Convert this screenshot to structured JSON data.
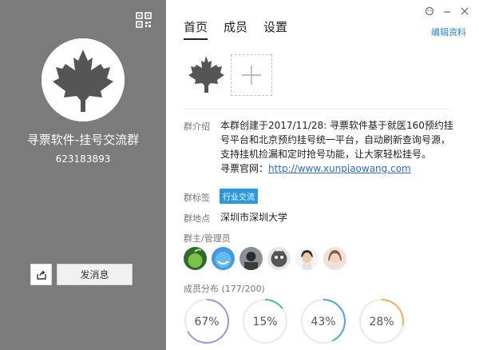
{
  "left_panel": {
    "group_name": "寻票软件-挂号交流群",
    "group_number": "623183893",
    "send_message_label": "发消息",
    "bg_color": "#7b7b7b"
  },
  "right_panel": {
    "tabs": [
      {
        "label": "首页",
        "active": true
      },
      {
        "label": "成员",
        "active": false
      },
      {
        "label": "设置",
        "active": false
      }
    ],
    "edit_profile": "编辑资料",
    "intro": {
      "label": "群介绍",
      "text": "本群创建于2017/11/28: 寻票软件基于就医160预约挂号平台和北京预约挂号统一平台，自动刷新查询号源，支持挂机捡漏和定时抢号功能，让大家轻松挂号。",
      "site_label": "寻票官网：",
      "site_url": "http://www.xunpiaowang.com"
    },
    "tag": {
      "label": "群标签",
      "value": "行业交流"
    },
    "location": {
      "label": "群地点",
      "value": "深圳市深圳大学"
    },
    "admins_label": "群主/管理员",
    "member_distribution": {
      "label": "成员分布",
      "count": "(177/200)",
      "percents": [
        "67%",
        "15%",
        "43%",
        "28%"
      ],
      "fractions": [
        0.67,
        0.15,
        0.43,
        0.28
      ],
      "colors": [
        "#a98ee8",
        "#39c6a0",
        "#4aa6e8",
        "#f0b050"
      ]
    }
  }
}
